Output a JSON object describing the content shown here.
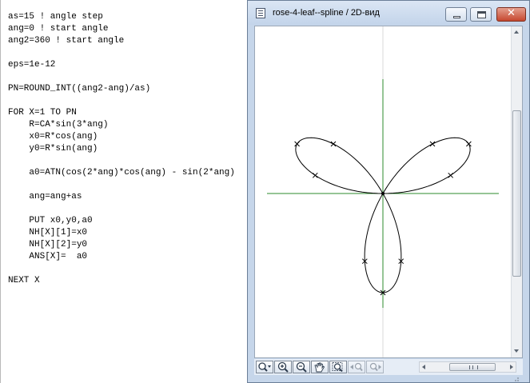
{
  "editor": {
    "lines": [
      "as=15 ! angle step",
      "ang=0 ! start angle",
      "ang2=360 ! start angle",
      "",
      "eps=1e-12",
      "",
      "PN=ROUND_INT((ang2-ang)/as)",
      "",
      "FOR X=1 TO PN",
      "    R=CA*sin(3*ang)",
      "    x0=R*cos(ang)",
      "    y0=R*sin(ang)",
      "",
      "    a0=ATN(cos(2*ang)*cos(ang) - sin(2*ang)",
      "",
      "    ang=ang+as",
      "",
      "    PUT x0,y0,a0",
      "    NH[X][1]=x0",
      "    NH[X][2]=y0",
      "    ANS[X]=  a0",
      "",
      "NEXT X"
    ]
  },
  "window": {
    "title": "rose-4-leaf--spline / 2D-вид",
    "close_glyph": "✕"
  },
  "colors": {
    "axis": "#2e8b2e",
    "curve": "#000000",
    "window_frame": "#c6d6ea"
  },
  "toolbar": {
    "tools": [
      {
        "icon": "zoom-menu-icon",
        "enabled": true
      },
      {
        "icon": "zoom-in-icon",
        "enabled": true
      },
      {
        "icon": "zoom-out-icon",
        "enabled": true
      },
      {
        "icon": "pan-hand-icon",
        "enabled": true
      },
      {
        "icon": "zoom-fit-icon",
        "enabled": true
      },
      {
        "icon": "zoom-previous-icon",
        "enabled": false
      },
      {
        "icon": "zoom-next-icon",
        "enabled": false
      }
    ]
  }
}
